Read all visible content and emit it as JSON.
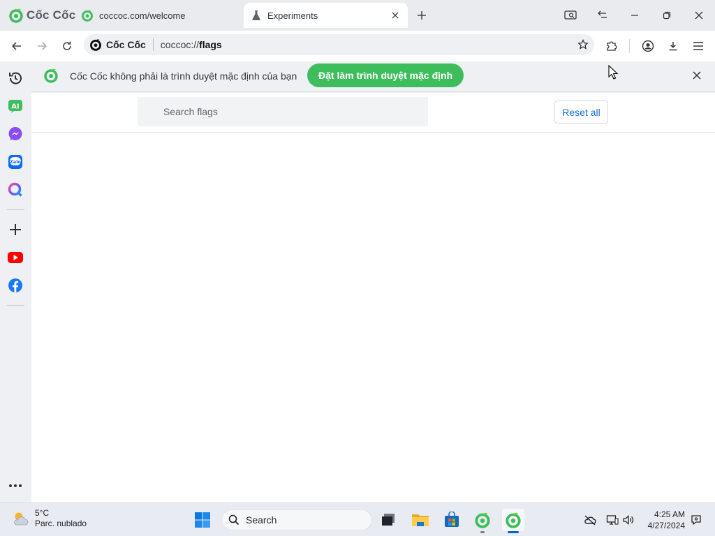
{
  "browser": {
    "brand_name": "Cốc Cốc",
    "tabs": [
      {
        "title": "coccoc.com/welcome",
        "active": false,
        "icon": "coccoc-logo-icon"
      },
      {
        "title": "Experiments",
        "active": true,
        "icon": "flask-icon"
      }
    ]
  },
  "toolbar": {
    "omnibox_brand": "Cốc Cốc",
    "url_scheme": "coccoc://",
    "url_host": "flags"
  },
  "infobar": {
    "message": "Cốc Cốc không phải là trình duyệt mặc định của bạn",
    "button_label": "Đặt làm trình duyệt mặc định"
  },
  "flags_page": {
    "search_placeholder": "Search flags",
    "reset_label": "Reset all"
  },
  "sidebar": {
    "items": [
      "history-icon",
      "ai-icon",
      "messenger-icon",
      "zalo-icon",
      "q-search-icon",
      "add-icon",
      "youtube-icon",
      "facebook-icon",
      "more-icon"
    ]
  },
  "taskbar": {
    "weather_temp": "5°C",
    "weather_desc": "Parc. nublado",
    "search_label": "Search",
    "time": "4:25 AM",
    "date": "4/27/2024"
  },
  "colors": {
    "accent_green": "#3ebd5d",
    "link_blue": "#1a6fd6",
    "youtube_red": "#ff0000",
    "facebook_blue": "#1877f2"
  }
}
